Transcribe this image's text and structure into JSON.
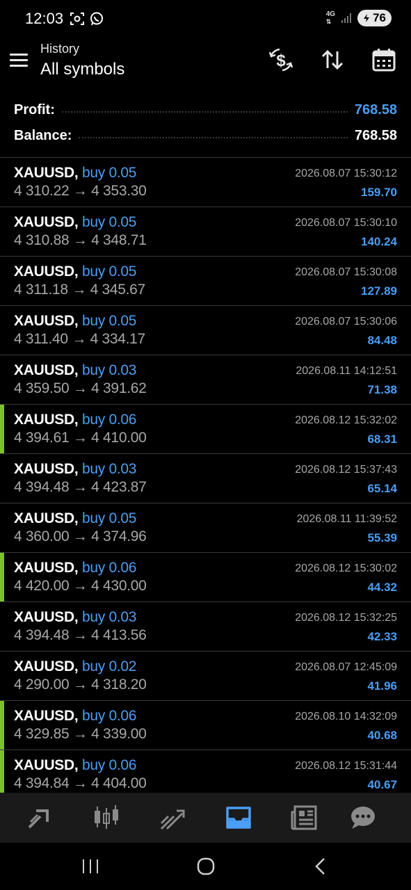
{
  "status_bar": {
    "time": "12:03",
    "battery": "76",
    "network": "4G"
  },
  "header": {
    "subtitle": "History",
    "title": "All symbols"
  },
  "summary": {
    "profit_label": "Profit:",
    "profit_value": "768.58",
    "balance_label": "Balance:",
    "balance_value": "768.58"
  },
  "colors": {
    "accent": "#4a9ef5",
    "marker": "#7cc02c",
    "bottom_nav": "#1a1a1a"
  },
  "trades": [
    {
      "symbol": "XAUUSD,",
      "type": "buy 0.05",
      "open": "4 310.22",
      "close": "4 353.30",
      "datetime": "2026.08.07 15:30:12",
      "profit": "159.70",
      "marked": false
    },
    {
      "symbol": "XAUUSD,",
      "type": "buy 0.05",
      "open": "4 310.88",
      "close": "4 348.71",
      "datetime": "2026.08.07 15:30:10",
      "profit": "140.24",
      "marked": false
    },
    {
      "symbol": "XAUUSD,",
      "type": "buy 0.05",
      "open": "4 311.18",
      "close": "4 345.67",
      "datetime": "2026.08.07 15:30:08",
      "profit": "127.89",
      "marked": false
    },
    {
      "symbol": "XAUUSD,",
      "type": "buy 0.05",
      "open": "4 311.40",
      "close": "4 334.17",
      "datetime": "2026.08.07 15:30:06",
      "profit": "84.48",
      "marked": false
    },
    {
      "symbol": "XAUUSD,",
      "type": "buy 0.03",
      "open": "4 359.50",
      "close": "4 391.62",
      "datetime": "2026.08.11 14:12:51",
      "profit": "71.38",
      "marked": false
    },
    {
      "symbol": "XAUUSD,",
      "type": "buy 0.06",
      "open": "4 394.61",
      "close": "4 410.00",
      "datetime": "2026.08.12 15:32:02",
      "profit": "68.31",
      "marked": true
    },
    {
      "symbol": "XAUUSD,",
      "type": "buy 0.03",
      "open": "4 394.48",
      "close": "4 423.87",
      "datetime": "2026.08.12 15:37:43",
      "profit": "65.14",
      "marked": false
    },
    {
      "symbol": "XAUUSD,",
      "type": "buy 0.05",
      "open": "4 360.00",
      "close": "4 374.96",
      "datetime": "2026.08.11 11:39:52",
      "profit": "55.39",
      "marked": false
    },
    {
      "symbol": "XAUUSD,",
      "type": "buy 0.06",
      "open": "4 420.00",
      "close": "4 430.00",
      "datetime": "2026.08.12 15:30:02",
      "profit": "44.32",
      "marked": true
    },
    {
      "symbol": "XAUUSD,",
      "type": "buy 0.03",
      "open": "4 394.48",
      "close": "4 413.56",
      "datetime": "2026.08.12 15:32:25",
      "profit": "42.33",
      "marked": false
    },
    {
      "symbol": "XAUUSD,",
      "type": "buy 0.02",
      "open": "4 290.00",
      "close": "4 318.20",
      "datetime": "2026.08.07 12:45:09",
      "profit": "41.96",
      "marked": false
    },
    {
      "symbol": "XAUUSD,",
      "type": "buy 0.06",
      "open": "4 329.85",
      "close": "4 339.00",
      "datetime": "2026.08.10 14:32:09",
      "profit": "40.68",
      "marked": true
    },
    {
      "symbol": "XAUUSD,",
      "type": "buy 0.06",
      "open": "4 394.84",
      "close": "4 404.00",
      "datetime": "2026.08.12 15:31:44",
      "profit": "40.67",
      "marked": true
    }
  ],
  "bottom_nav": {
    "items": [
      "quotes-icon",
      "chart-icon",
      "trade-icon",
      "history-icon",
      "news-icon",
      "chat-icon"
    ],
    "active": "history-icon"
  }
}
